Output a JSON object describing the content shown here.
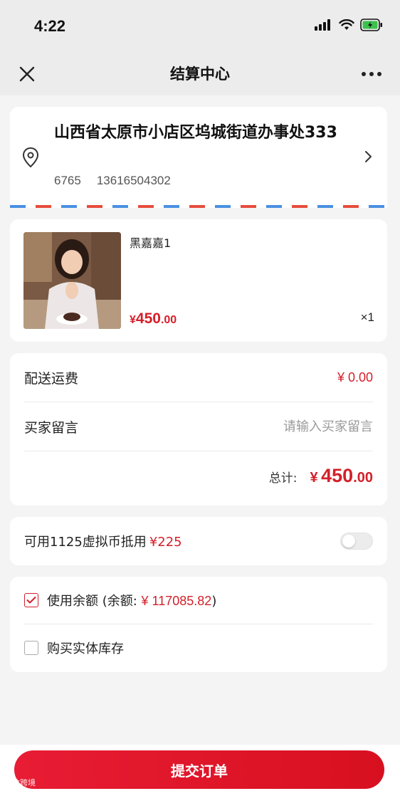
{
  "status_bar": {
    "time": "4:22"
  },
  "nav": {
    "title": "结算中心",
    "close_icon": "close-icon",
    "more_icon": "more-icon"
  },
  "address": {
    "line": "山西省太原市小店区坞城街道办事处333",
    "name": "6765",
    "phone": "13616504302"
  },
  "product": {
    "name": "黑嘉嘉1",
    "price_symbol": "¥",
    "price_int": "450",
    "price_dec": ".00",
    "quantity": "×1"
  },
  "fees": {
    "shipping_label": "配送运费",
    "shipping_value": "¥ 0.00",
    "message_label": "买家留言",
    "message_placeholder": "请输入买家留言",
    "message_value": "",
    "total_label": "总计:",
    "total_symbol": "¥",
    "total_int": "450",
    "total_dec": ".00"
  },
  "coins": {
    "label": "可用1125虚拟币抵用",
    "amount": "¥225",
    "enabled": false
  },
  "options": {
    "balance_label": "使用余额 (余额:",
    "balance_amount": "¥ 117085.82",
    "balance_close": ")",
    "balance_checked": true,
    "stock_label": "购买实体库存",
    "stock_checked": false
  },
  "footer": {
    "submit_label": "提交订单"
  },
  "watermark": "大数跨境",
  "colors": {
    "accent": "#d4202a",
    "airmail_blue": "#4a90e2",
    "airmail_red": "#e74c3c"
  }
}
